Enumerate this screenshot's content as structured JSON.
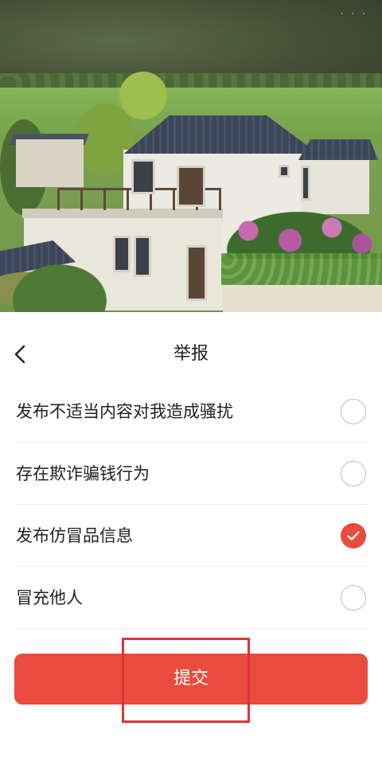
{
  "header": {
    "title": "举报"
  },
  "options": [
    {
      "label": "发布不适当内容对我造成骚扰",
      "selected": false
    },
    {
      "label": "存在欺诈骗钱行为",
      "selected": false
    },
    {
      "label": "发布仿冒品信息",
      "selected": true
    },
    {
      "label": "冒充他人",
      "selected": false
    }
  ],
  "submit": {
    "label": "提交"
  },
  "hero": {
    "more_indicator": "· · ·"
  },
  "colors": {
    "accent": "#e94b3c",
    "highlight": "#e0323a"
  }
}
